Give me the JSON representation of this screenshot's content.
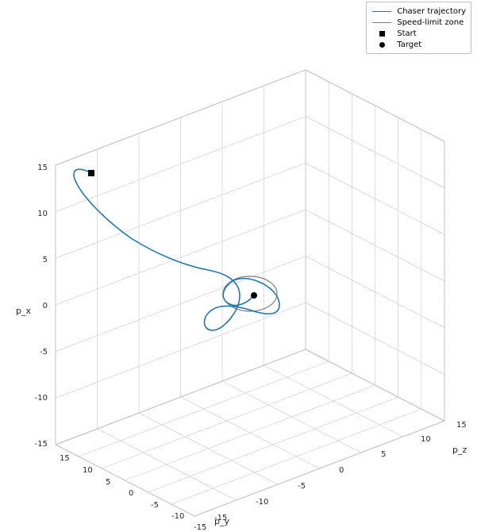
{
  "legend": {
    "items": [
      {
        "label": "Chaser trajectory",
        "kind": "line",
        "color": "#1f77b4"
      },
      {
        "label": "Speed-limit zone",
        "kind": "line",
        "color": "#808080"
      },
      {
        "label": "Start",
        "kind": "square",
        "color": "#000000"
      },
      {
        "label": "Target",
        "kind": "circle",
        "color": "#000000"
      }
    ]
  },
  "axes": {
    "x": {
      "label": "p_y",
      "ticks": [
        "15",
        "10",
        "5",
        "0",
        "-5",
        "-10",
        "-15"
      ]
    },
    "y": {
      "label": "p_z",
      "ticks": [
        "-15",
        "-10",
        "-5",
        "0",
        "5",
        "10",
        "15"
      ]
    },
    "z": {
      "label": "p_x",
      "ticks": [
        "-15",
        "-10",
        "-5",
        "0",
        "5",
        "10",
        "15"
      ]
    }
  },
  "chart_data": {
    "type": "line",
    "title": "",
    "xlabel": "p_y",
    "ylabel": "p_z",
    "zlabel": "p_x",
    "xlim": [
      -15,
      15
    ],
    "ylim": [
      -15,
      15
    ],
    "zlim": [
      -15,
      15
    ],
    "series": [
      {
        "name": "Chaser trajectory",
        "color": "#1f77b4",
        "points_xyz": [
          [
            12.0,
            -12.0,
            14.0
          ],
          [
            11.5,
            -11.2,
            14.2
          ],
          [
            10.8,
            -10.2,
            14.4
          ],
          [
            10.0,
            -9.0,
            14.5
          ],
          [
            9.0,
            -7.5,
            14.5
          ],
          [
            7.8,
            -5.8,
            14.4
          ],
          [
            6.5,
            -4.0,
            14.2
          ],
          [
            5.2,
            -2.3,
            13.8
          ],
          [
            3.8,
            -0.6,
            13.2
          ],
          [
            2.5,
            0.8,
            12.4
          ],
          [
            1.4,
            1.8,
            11.4
          ],
          [
            0.5,
            2.4,
            10.2
          ],
          [
            -0.2,
            2.6,
            8.8
          ],
          [
            -0.6,
            2.4,
            7.4
          ],
          [
            -0.7,
            2.0,
            6.0
          ],
          [
            -0.6,
            1.4,
            4.8
          ],
          [
            -0.2,
            0.7,
            3.8
          ],
          [
            0.3,
            0.0,
            3.0
          ],
          [
            0.9,
            -0.6,
            2.6
          ],
          [
            1.5,
            -1.0,
            2.4
          ],
          [
            2.1,
            -1.1,
            2.4
          ],
          [
            2.6,
            -0.9,
            2.5
          ],
          [
            2.8,
            -0.4,
            2.7
          ],
          [
            2.7,
            0.2,
            2.8
          ],
          [
            2.3,
            0.7,
            2.8
          ],
          [
            1.7,
            0.9,
            2.7
          ],
          [
            1.1,
            0.8,
            2.4
          ],
          [
            0.7,
            0.4,
            2.0
          ],
          [
            0.5,
            -0.1,
            1.6
          ],
          [
            0.7,
            -0.6,
            1.2
          ],
          [
            1.1,
            -0.9,
            0.9
          ],
          [
            1.6,
            -0.9,
            0.6
          ],
          [
            2.0,
            -0.6,
            0.4
          ],
          [
            2.2,
            -0.2,
            0.2
          ],
          [
            2.0,
            0.2,
            0.1
          ],
          [
            1.6,
            0.4,
            0.05
          ],
          [
            1.1,
            0.3,
            0.02
          ],
          [
            0.6,
            0.1,
            0.0
          ],
          [
            0.2,
            0.0,
            0.0
          ],
          [
            0.0,
            0.0,
            0.0
          ]
        ]
      },
      {
        "name": "Speed-limit zone",
        "color": "#808080",
        "shape": "circle",
        "center_xyz": [
          0,
          0,
          0
        ],
        "radius": 2.0,
        "plane": "xy_at_z0"
      }
    ],
    "markers": [
      {
        "name": "Start",
        "shape": "square",
        "xyz": [
          12.0,
          -12.0,
          14.0
        ]
      },
      {
        "name": "Target",
        "shape": "circle",
        "xyz": [
          0.0,
          0.0,
          0.0
        ]
      }
    ]
  }
}
